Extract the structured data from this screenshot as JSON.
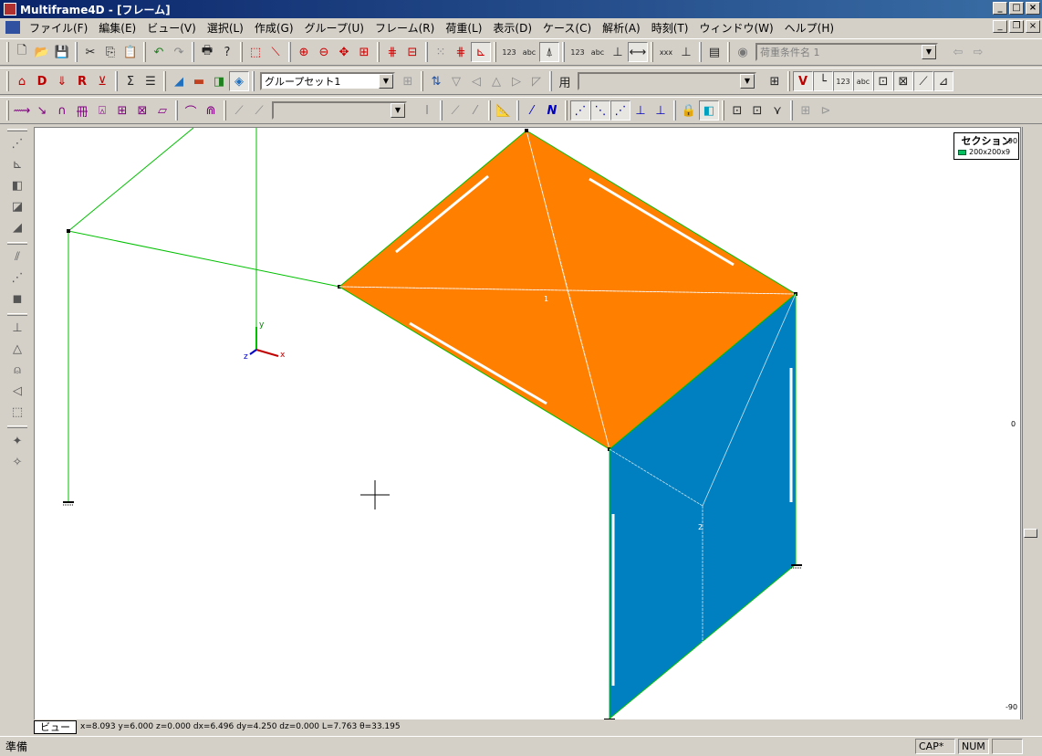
{
  "window": {
    "title": "Multiframe4D - [フレーム]"
  },
  "menu": [
    "ファイル(F)",
    "編集(E)",
    "ビュー(V)",
    "選択(L)",
    "作成(G)",
    "グループ(U)",
    "フレーム(R)",
    "荷重(L)",
    "表示(D)",
    "ケース(C)",
    "解析(A)",
    "時刻(T)",
    "ウィンドウ(W)",
    "ヘルプ(H)"
  ],
  "toolbar1": {
    "load_case_combo": "荷重条件名 1"
  },
  "toolbar2": {
    "group_set_combo": "グループセット1",
    "empty_combo": ""
  },
  "toolbar3": {
    "section_combo": ""
  },
  "canvas": {
    "ruler_labels": [
      "-90",
      "0",
      "-90"
    ],
    "member_label_1": "1",
    "member_label_2": "2",
    "axis_y": "y",
    "axis_x": "x",
    "axis_z": "z"
  },
  "legend": {
    "title": "セクション",
    "item": "200x200x9",
    "color": "#00c060"
  },
  "coordbar": {
    "view_tab": "ビュー",
    "coords": "x=8.093  y=6.000  z=0.000  dx=6.496  dy=4.250  dz=0.000  L=7.763  θ=33.195"
  },
  "statusbar": {
    "text": "準備",
    "cap": "CAP*",
    "num": "NUM"
  },
  "colors": {
    "roof_plate": "#ff8000",
    "wall_plate": "#0080c0",
    "member": "#00c000"
  }
}
